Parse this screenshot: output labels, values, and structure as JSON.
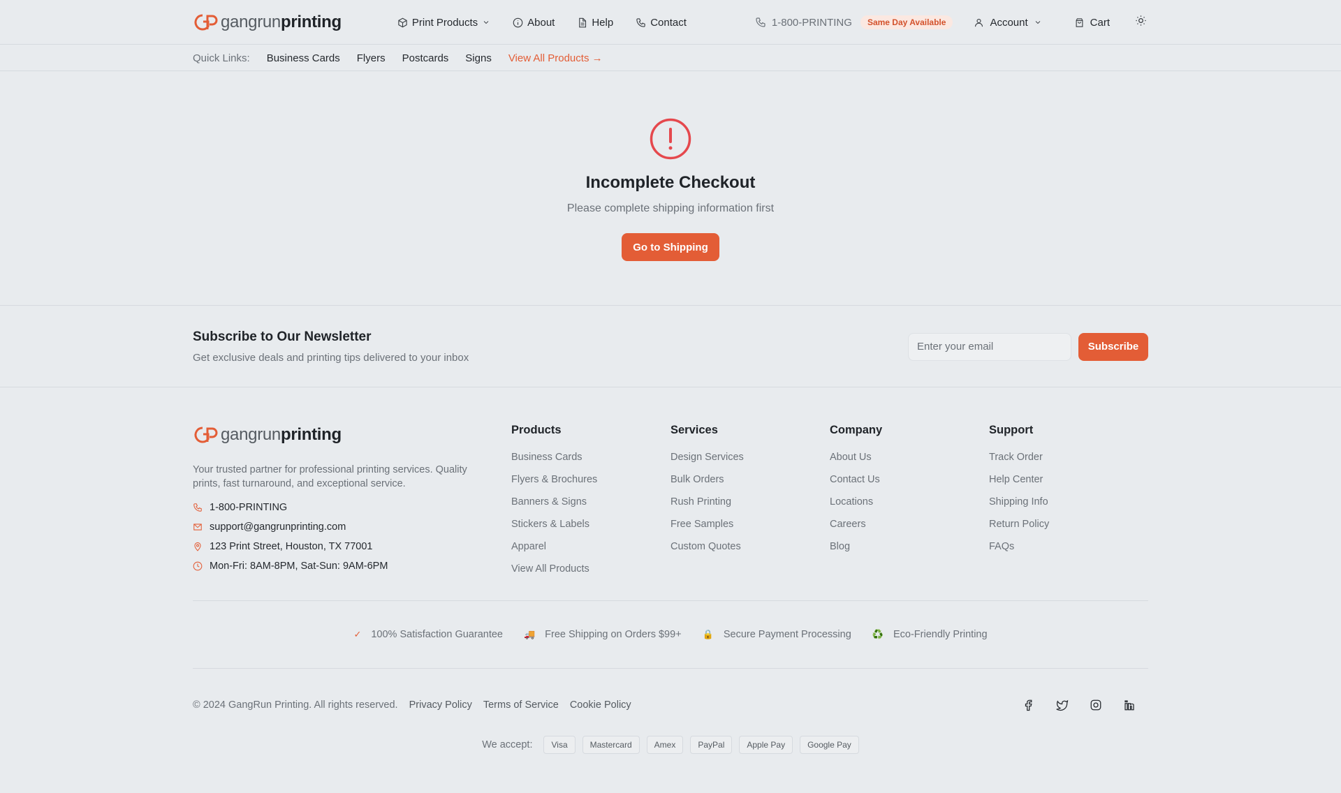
{
  "brand": {
    "name_light": "gangrun",
    "name_bold": "printing",
    "accent": "#e35d36"
  },
  "header": {
    "nav": [
      {
        "label": "Print Products",
        "icon": "box-icon",
        "dropdown": true
      },
      {
        "label": "About",
        "icon": "info-icon"
      },
      {
        "label": "Help",
        "icon": "document-icon"
      },
      {
        "label": "Contact",
        "icon": "phone-icon"
      }
    ],
    "phone": "1-800-PRINTING",
    "badge": "Same Day Available",
    "account": "Account",
    "cart": "Cart"
  },
  "quick_links": {
    "label": "Quick Links:",
    "items": [
      "Business Cards",
      "Flyers",
      "Postcards",
      "Signs"
    ],
    "view_all": "View All Products →"
  },
  "main": {
    "title": "Incomplete Checkout",
    "subtitle": "Please complete shipping information first",
    "button": "Go to Shipping"
  },
  "newsletter": {
    "title": "Subscribe to Our Newsletter",
    "subtitle": "Get exclusive deals and printing tips delivered to your inbox",
    "placeholder": "Enter your email",
    "button": "Subscribe"
  },
  "footer": {
    "description": "Your trusted partner for professional printing services. Quality prints, fast turnaround, and exceptional service.",
    "contact": {
      "phone": "1-800-PRINTING",
      "email": "support@gangrunprinting.com",
      "address": "123 Print Street, Houston, TX 77001",
      "hours": "Mon-Fri: 8AM-8PM, Sat-Sun: 9AM-6PM"
    },
    "columns": [
      {
        "title": "Products",
        "links": [
          "Business Cards",
          "Flyers & Brochures",
          "Banners & Signs",
          "Stickers & Labels",
          "Apparel",
          "View All Products"
        ]
      },
      {
        "title": "Services",
        "links": [
          "Design Services",
          "Bulk Orders",
          "Rush Printing",
          "Free Samples",
          "Custom Quotes"
        ]
      },
      {
        "title": "Company",
        "links": [
          "About Us",
          "Contact Us",
          "Locations",
          "Careers",
          "Blog"
        ]
      },
      {
        "title": "Support",
        "links": [
          "Track Order",
          "Help Center",
          "Shipping Info",
          "Return Policy",
          "FAQs"
        ]
      }
    ],
    "trust": [
      {
        "icon": "✓",
        "label": "100% Satisfaction Guarantee"
      },
      {
        "icon": "🚚",
        "label": "Free Shipping on Orders $99+"
      },
      {
        "icon": "🔒",
        "label": "Secure Payment Processing"
      },
      {
        "icon": "♻️",
        "label": "Eco-Friendly Printing"
      }
    ],
    "copyright": "© 2024 GangRun Printing. All rights reserved.",
    "legal": [
      "Privacy Policy",
      "Terms of Service",
      "Cookie Policy"
    ],
    "social": [
      "facebook-icon",
      "twitter-icon",
      "instagram-icon",
      "linkedin-icon"
    ],
    "pay_label": "We accept:",
    "payments": [
      "Visa",
      "Mastercard",
      "Amex",
      "PayPal",
      "Apple Pay",
      "Google Pay"
    ]
  }
}
